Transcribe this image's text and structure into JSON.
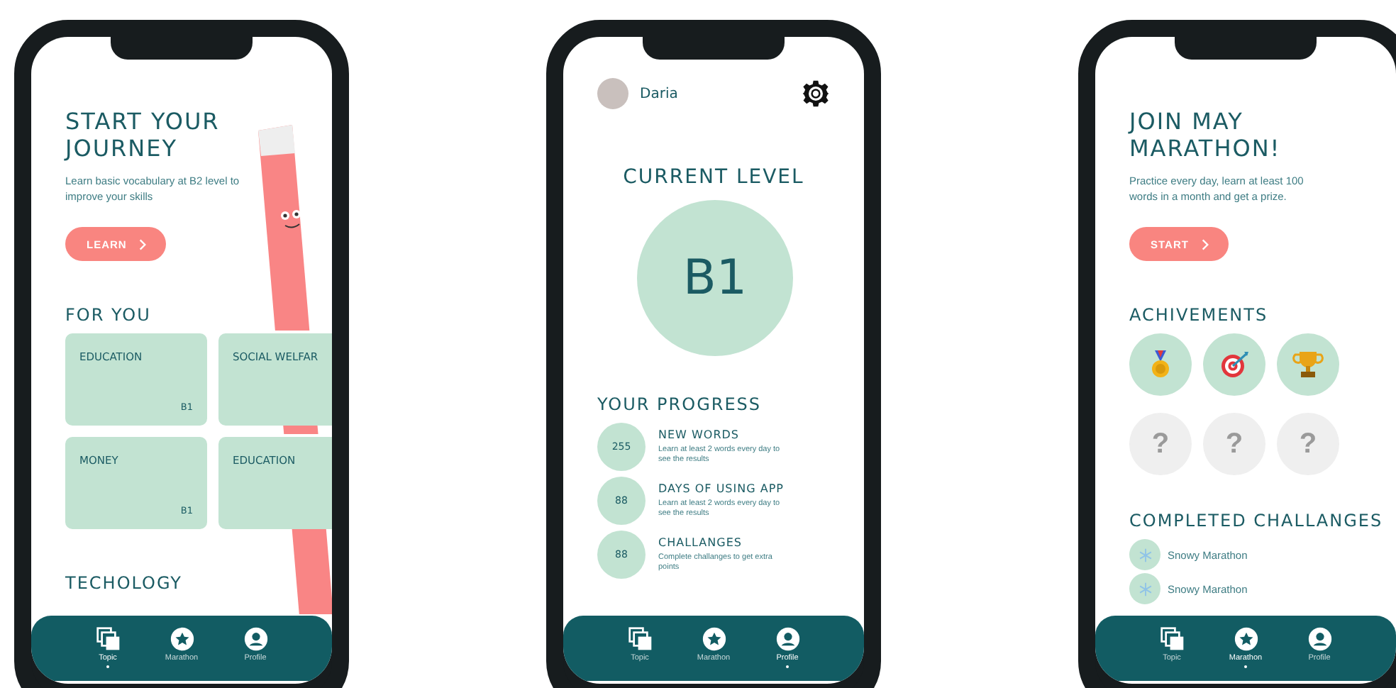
{
  "phones": [
    {
      "kind": "topics",
      "title": "START YOUR JOURNEY",
      "text": "Learn basic vocabulary at B2 level to improve your skills",
      "button": "LEARN",
      "sections": [
        {
          "title": "FOR YOU",
          "cards": [
            {
              "title": "EDUCATION",
              "level": "B1"
            },
            {
              "title": "SOCIAL WELFAR"
            },
            {
              "title": "MONEY",
              "level": "B1"
            },
            {
              "title": "EDUCATION"
            }
          ]
        },
        {
          "title": "TECHOLOGY"
        }
      ],
      "nav": [
        {
          "kind": "topic",
          "label": "Topic",
          "selected": true
        },
        {
          "kind": "marathon",
          "label": "Marathon",
          "selected": false
        },
        {
          "kind": "profile",
          "label": "Profile",
          "selected": false
        }
      ]
    },
    {
      "kind": "profile",
      "user": "Daria",
      "level_title": "CURRENT LEVEL",
      "level": "B1",
      "progress_title": "YOUR PROGRESS",
      "progress": [
        {
          "value": "255",
          "title": "NEW WORDS",
          "text": "Learn at least 2 words every day to see the results"
        },
        {
          "value": "88",
          "title": "DAYS OF USING APP",
          "text": "Learn at least 2 words every day to see the results"
        },
        {
          "value": "88",
          "title": "CHALLANGES",
          "text": "Complete challanges to get extra points"
        }
      ],
      "nav": [
        {
          "kind": "topic",
          "label": "Topic",
          "selected": false
        },
        {
          "kind": "marathon",
          "label": "Marathon",
          "selected": false
        },
        {
          "kind": "profile",
          "label": "Profile",
          "selected": true
        }
      ]
    },
    {
      "kind": "marathon",
      "title": "JOIN MAY MARATHON!",
      "text": "Practice every day, learn at least 100 words in a month and get a prize.",
      "button": "START",
      "achievements_title": "ACHIVEMENTS",
      "achievements": [
        {
          "kind": "medal"
        },
        {
          "kind": "target"
        },
        {
          "kind": "trophy"
        },
        {
          "kind": "locked",
          "label": "?"
        },
        {
          "kind": "locked",
          "label": "?"
        },
        {
          "kind": "locked",
          "label": "?"
        }
      ],
      "completed_title": "COMPLETED CHALLANGES",
      "completed": [
        "Snowy Marathon",
        "Snowy Marathon"
      ],
      "nav": [
        {
          "kind": "topic",
          "label": "Topic",
          "selected": false
        },
        {
          "kind": "marathon",
          "label": "Marathon",
          "selected": true
        },
        {
          "kind": "profile",
          "label": "Profile",
          "selected": false
        }
      ]
    }
  ]
}
